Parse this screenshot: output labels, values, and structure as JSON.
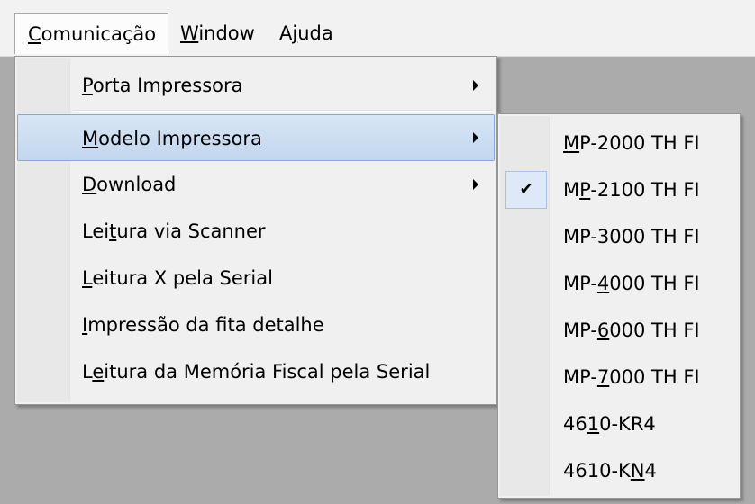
{
  "menubar": {
    "items": [
      {
        "pre": "",
        "ul": "C",
        "post": "omunicação"
      },
      {
        "pre": "",
        "ul": "W",
        "post": "indow"
      },
      {
        "pre": "A",
        "ul": "j",
        "post": "uda"
      }
    ]
  },
  "main_menu": {
    "items": [
      {
        "pre": "",
        "ul": "P",
        "post": "orta Impressora",
        "submenu": true
      },
      {
        "pre": "",
        "ul": "M",
        "post": "odelo Impressora",
        "submenu": true,
        "highlighted": true
      },
      {
        "pre": "",
        "ul": "D",
        "post": "ownload",
        "submenu": true
      },
      {
        "pre": "Lei",
        "ul": "t",
        "post": "ura via Scanner"
      },
      {
        "pre": "",
        "ul": "L",
        "post": "eitura X pela Serial"
      },
      {
        "pre": "",
        "ul": "I",
        "post": "mpressão da fita detalhe"
      },
      {
        "pre": "L",
        "ul": "e",
        "post": "itura da Memória Fiscal pela Serial"
      }
    ]
  },
  "submenu": {
    "items": [
      {
        "pre": "",
        "ul": "M",
        "post": "P-2000 TH FI",
        "checked": false
      },
      {
        "pre": "M",
        "ul": "P",
        "post": "-2100 TH FI",
        "checked": true
      },
      {
        "pre": "MP-3000 TH FI",
        "ul": "",
        "post": "",
        "checked": false
      },
      {
        "pre": "MP-",
        "ul": "4",
        "post": "000 TH FI",
        "checked": false
      },
      {
        "pre": "MP-",
        "ul": "6",
        "post": "000 TH FI",
        "checked": false
      },
      {
        "pre": "MP-",
        "ul": "7",
        "post": "000 TH FI",
        "checked": false
      },
      {
        "pre": "46",
        "ul": "1",
        "post": "0-KR4",
        "checked": false
      },
      {
        "pre": "4610-K",
        "ul": "N",
        "post": "4",
        "checked": false
      }
    ],
    "check_glyph": "✔"
  }
}
